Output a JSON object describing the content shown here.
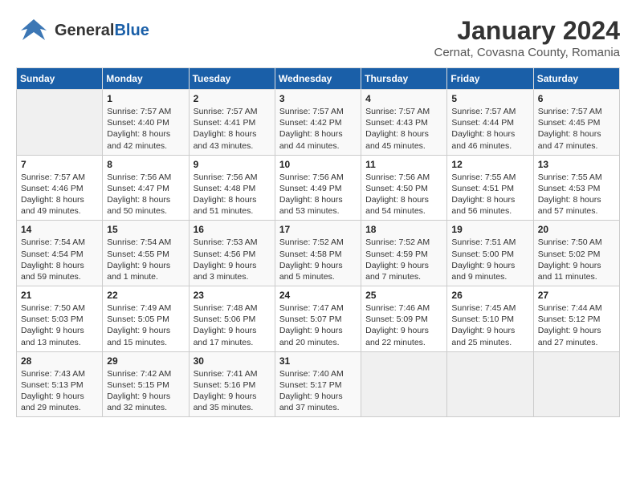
{
  "header": {
    "logo_general": "General",
    "logo_blue": "Blue",
    "month_year": "January 2024",
    "location": "Cernat, Covasna County, Romania"
  },
  "weekdays": [
    "Sunday",
    "Monday",
    "Tuesday",
    "Wednesday",
    "Thursday",
    "Friday",
    "Saturday"
  ],
  "weeks": [
    [
      {
        "day": "",
        "info": ""
      },
      {
        "day": "1",
        "info": "Sunrise: 7:57 AM\nSunset: 4:40 PM\nDaylight: 8 hours\nand 42 minutes."
      },
      {
        "day": "2",
        "info": "Sunrise: 7:57 AM\nSunset: 4:41 PM\nDaylight: 8 hours\nand 43 minutes."
      },
      {
        "day": "3",
        "info": "Sunrise: 7:57 AM\nSunset: 4:42 PM\nDaylight: 8 hours\nand 44 minutes."
      },
      {
        "day": "4",
        "info": "Sunrise: 7:57 AM\nSunset: 4:43 PM\nDaylight: 8 hours\nand 45 minutes."
      },
      {
        "day": "5",
        "info": "Sunrise: 7:57 AM\nSunset: 4:44 PM\nDaylight: 8 hours\nand 46 minutes."
      },
      {
        "day": "6",
        "info": "Sunrise: 7:57 AM\nSunset: 4:45 PM\nDaylight: 8 hours\nand 47 minutes."
      }
    ],
    [
      {
        "day": "7",
        "info": "Sunrise: 7:57 AM\nSunset: 4:46 PM\nDaylight: 8 hours\nand 49 minutes."
      },
      {
        "day": "8",
        "info": "Sunrise: 7:56 AM\nSunset: 4:47 PM\nDaylight: 8 hours\nand 50 minutes."
      },
      {
        "day": "9",
        "info": "Sunrise: 7:56 AM\nSunset: 4:48 PM\nDaylight: 8 hours\nand 51 minutes."
      },
      {
        "day": "10",
        "info": "Sunrise: 7:56 AM\nSunset: 4:49 PM\nDaylight: 8 hours\nand 53 minutes."
      },
      {
        "day": "11",
        "info": "Sunrise: 7:56 AM\nSunset: 4:50 PM\nDaylight: 8 hours\nand 54 minutes."
      },
      {
        "day": "12",
        "info": "Sunrise: 7:55 AM\nSunset: 4:51 PM\nDaylight: 8 hours\nand 56 minutes."
      },
      {
        "day": "13",
        "info": "Sunrise: 7:55 AM\nSunset: 4:53 PM\nDaylight: 8 hours\nand 57 minutes."
      }
    ],
    [
      {
        "day": "14",
        "info": "Sunrise: 7:54 AM\nSunset: 4:54 PM\nDaylight: 8 hours\nand 59 minutes."
      },
      {
        "day": "15",
        "info": "Sunrise: 7:54 AM\nSunset: 4:55 PM\nDaylight: 9 hours\nand 1 minute."
      },
      {
        "day": "16",
        "info": "Sunrise: 7:53 AM\nSunset: 4:56 PM\nDaylight: 9 hours\nand 3 minutes."
      },
      {
        "day": "17",
        "info": "Sunrise: 7:52 AM\nSunset: 4:58 PM\nDaylight: 9 hours\nand 5 minutes."
      },
      {
        "day": "18",
        "info": "Sunrise: 7:52 AM\nSunset: 4:59 PM\nDaylight: 9 hours\nand 7 minutes."
      },
      {
        "day": "19",
        "info": "Sunrise: 7:51 AM\nSunset: 5:00 PM\nDaylight: 9 hours\nand 9 minutes."
      },
      {
        "day": "20",
        "info": "Sunrise: 7:50 AM\nSunset: 5:02 PM\nDaylight: 9 hours\nand 11 minutes."
      }
    ],
    [
      {
        "day": "21",
        "info": "Sunrise: 7:50 AM\nSunset: 5:03 PM\nDaylight: 9 hours\nand 13 minutes."
      },
      {
        "day": "22",
        "info": "Sunrise: 7:49 AM\nSunset: 5:05 PM\nDaylight: 9 hours\nand 15 minutes."
      },
      {
        "day": "23",
        "info": "Sunrise: 7:48 AM\nSunset: 5:06 PM\nDaylight: 9 hours\nand 17 minutes."
      },
      {
        "day": "24",
        "info": "Sunrise: 7:47 AM\nSunset: 5:07 PM\nDaylight: 9 hours\nand 20 minutes."
      },
      {
        "day": "25",
        "info": "Sunrise: 7:46 AM\nSunset: 5:09 PM\nDaylight: 9 hours\nand 22 minutes."
      },
      {
        "day": "26",
        "info": "Sunrise: 7:45 AM\nSunset: 5:10 PM\nDaylight: 9 hours\nand 25 minutes."
      },
      {
        "day": "27",
        "info": "Sunrise: 7:44 AM\nSunset: 5:12 PM\nDaylight: 9 hours\nand 27 minutes."
      }
    ],
    [
      {
        "day": "28",
        "info": "Sunrise: 7:43 AM\nSunset: 5:13 PM\nDaylight: 9 hours\nand 29 minutes."
      },
      {
        "day": "29",
        "info": "Sunrise: 7:42 AM\nSunset: 5:15 PM\nDaylight: 9 hours\nand 32 minutes."
      },
      {
        "day": "30",
        "info": "Sunrise: 7:41 AM\nSunset: 5:16 PM\nDaylight: 9 hours\nand 35 minutes."
      },
      {
        "day": "31",
        "info": "Sunrise: 7:40 AM\nSunset: 5:17 PM\nDaylight: 9 hours\nand 37 minutes."
      },
      {
        "day": "",
        "info": ""
      },
      {
        "day": "",
        "info": ""
      },
      {
        "day": "",
        "info": ""
      }
    ]
  ]
}
